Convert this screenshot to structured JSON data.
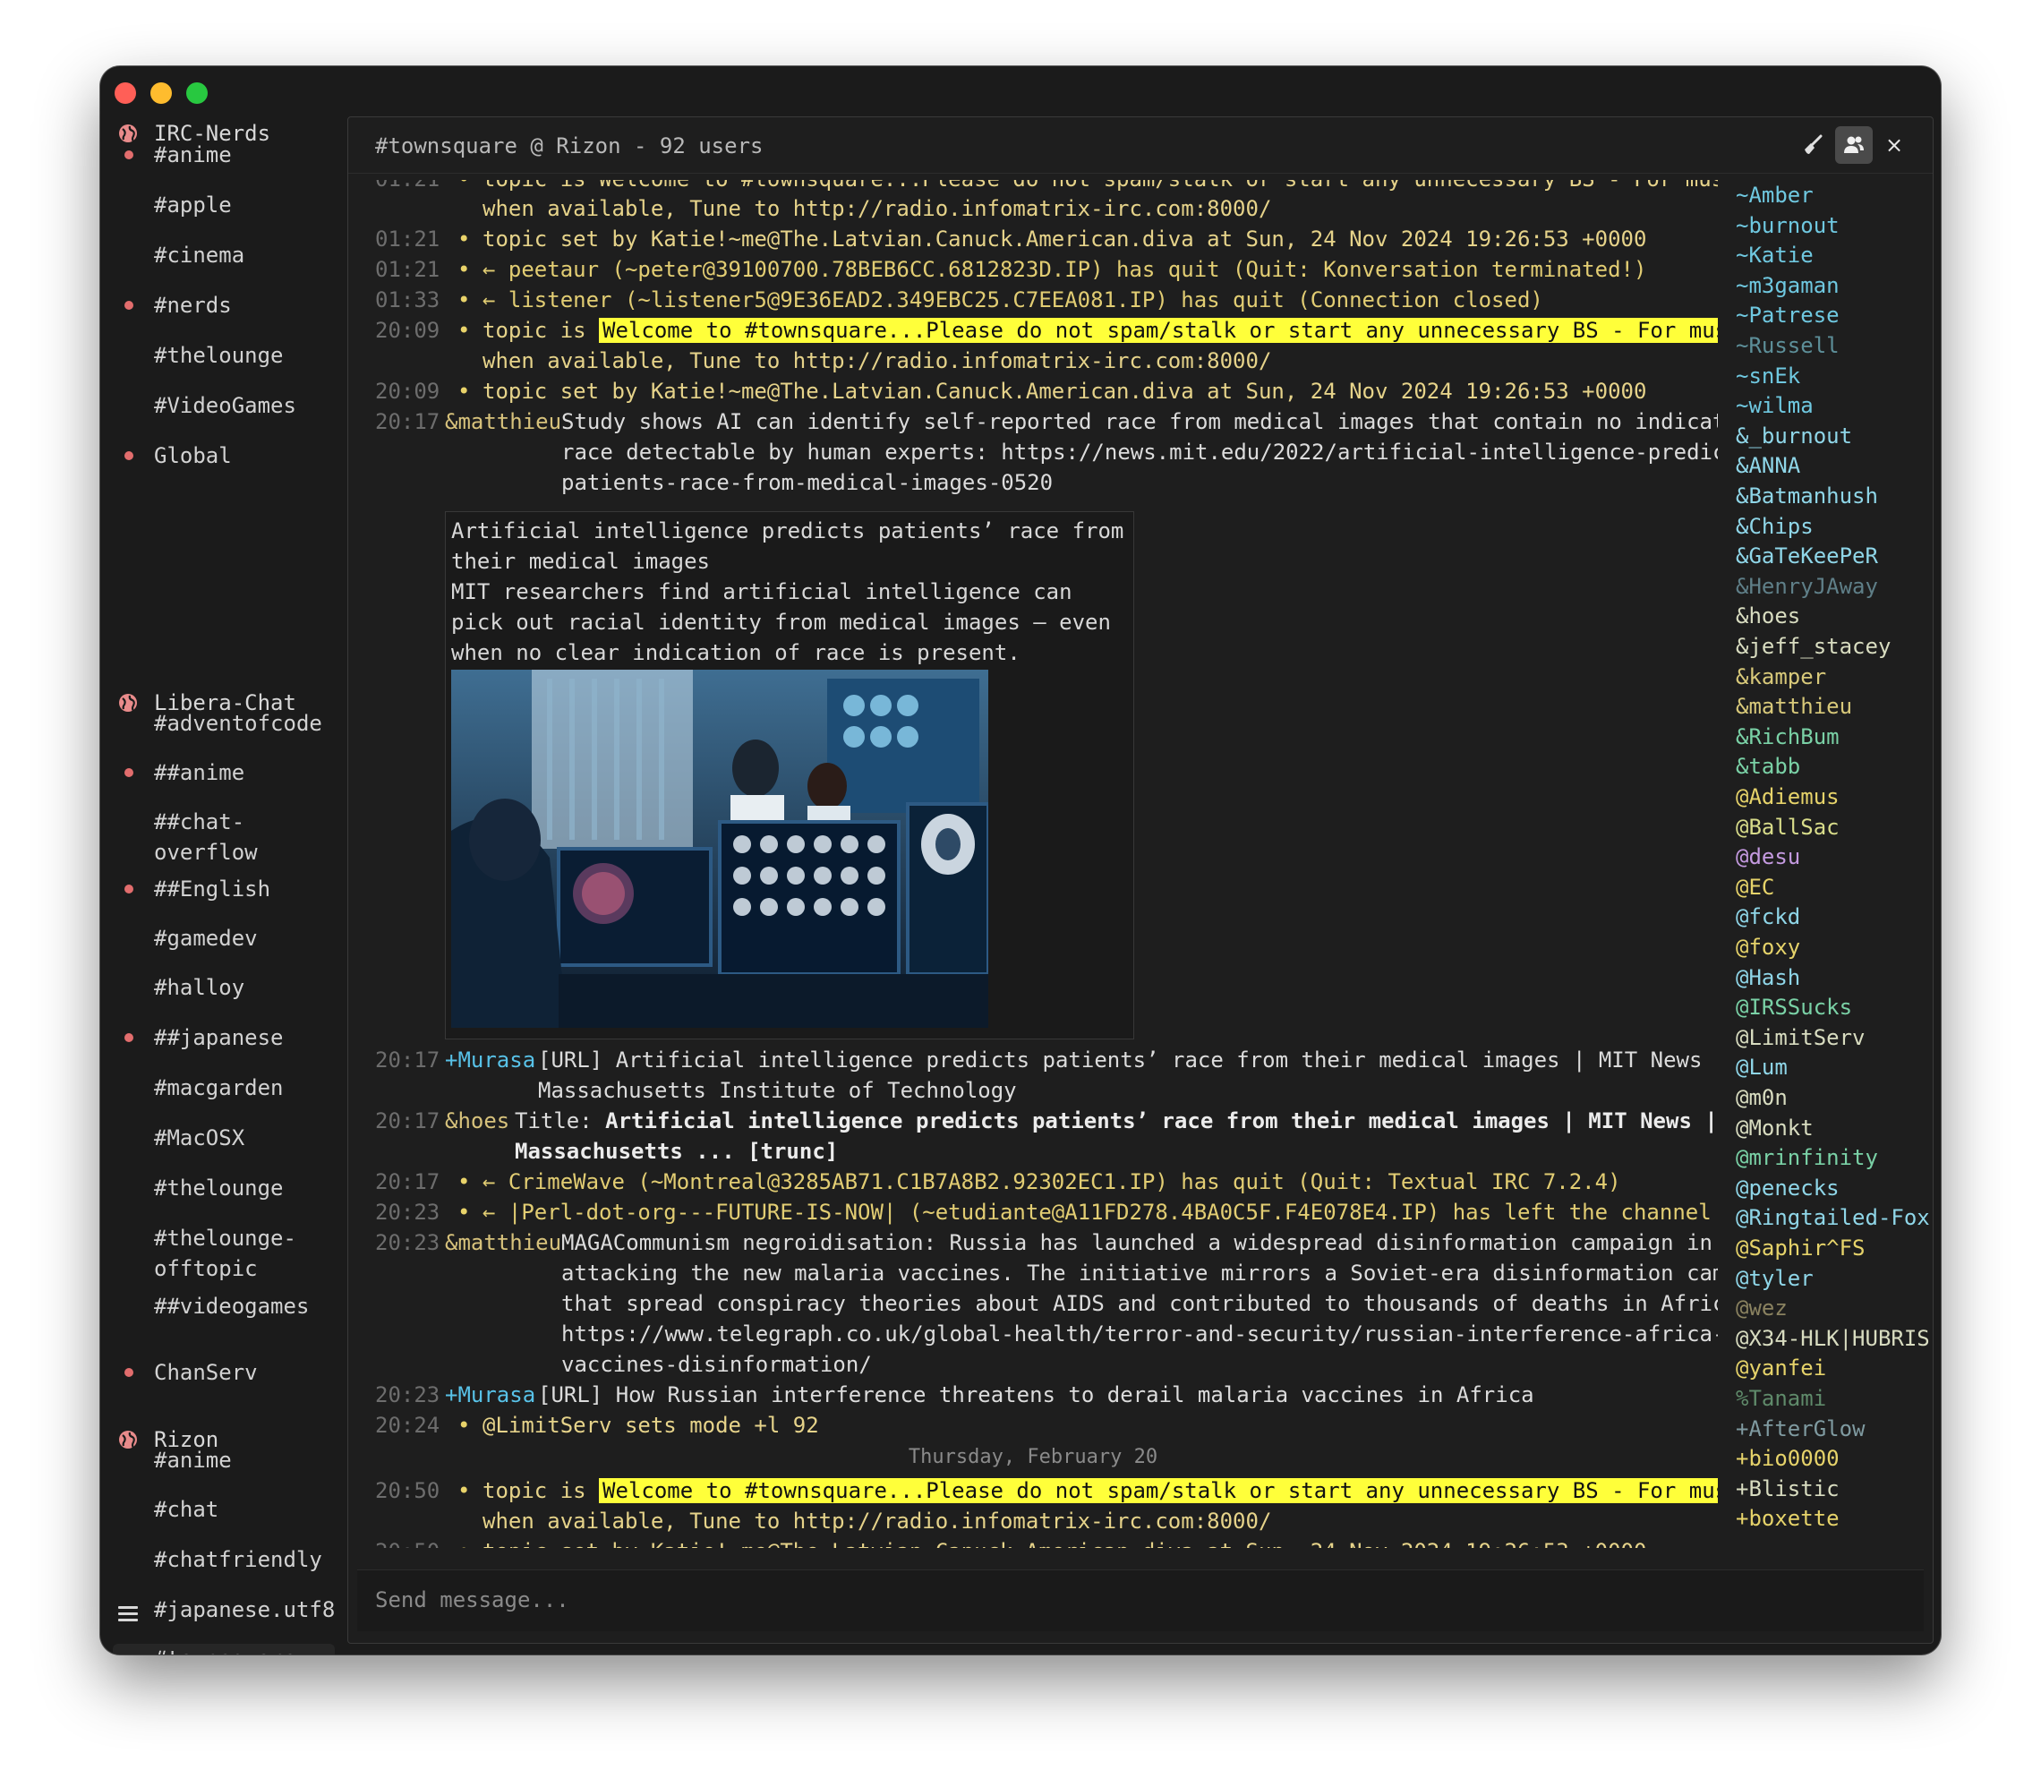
{
  "window": {
    "traffic_lights": [
      "close",
      "minimize",
      "zoom"
    ]
  },
  "sidebar": {
    "networks": [
      {
        "name": "IRC-Nerds",
        "channels": [
          {
            "label": "#anime",
            "unread": true
          },
          {
            "label": "#apple",
            "unread": false
          },
          {
            "label": "#cinema",
            "unread": false
          },
          {
            "label": "#nerds",
            "unread": true
          },
          {
            "label": "#thelounge",
            "unread": false
          },
          {
            "label": "#VideoGames",
            "unread": false
          },
          {
            "label": "Global",
            "unread": true
          }
        ]
      },
      {
        "name": "Libera-Chat",
        "channels": [
          {
            "label": "#adventofcode",
            "unread": false
          },
          {
            "label": "##anime",
            "unread": true
          },
          {
            "label": "##chat-overflow",
            "line1": "##chat-",
            "line2": "overflow",
            "unread": false
          },
          {
            "label": "##English",
            "unread": true
          },
          {
            "label": "#gamedev",
            "unread": false
          },
          {
            "label": "#halloy",
            "unread": false
          },
          {
            "label": "##japanese",
            "unread": true
          },
          {
            "label": "#macgarden",
            "unread": false
          },
          {
            "label": "#MacOSX",
            "unread": false
          },
          {
            "label": "#thelounge",
            "unread": false
          },
          {
            "label": "#thelounge-offtopic",
            "line1": "#thelounge-",
            "line2": "offtopic",
            "unread": false
          },
          {
            "label": "##videogames",
            "unread": false
          },
          {
            "label": "ChanServ",
            "unread": true
          }
        ]
      },
      {
        "name": "Rizon",
        "channels": [
          {
            "label": "#anime",
            "unread": false
          },
          {
            "label": "#chat",
            "unread": false
          },
          {
            "label": "#chatfriendly",
            "unread": false
          },
          {
            "label": "#japanese.utf8",
            "unread": false
          },
          {
            "label": "#townsquare",
            "unread": false,
            "active": true
          }
        ]
      }
    ],
    "menu_icon": "hamburger-menu-icon"
  },
  "header": {
    "title": "#townsquare @ Rizon - 92 users",
    "buttons": [
      {
        "icon": "broom-icon",
        "label": "clear"
      },
      {
        "icon": "users-icon",
        "label": "toggle nicklist"
      },
      {
        "icon": "close-icon",
        "label": "×"
      }
    ]
  },
  "messages": {
    "cutoff_top": {
      "ts": "01:21",
      "text": "topic is  Welcome to #townsquare...Please do not spam/stalk or start any unnecessary BS  -   For music and"
    },
    "line_cont_1": "when available, Tune to http://radio.infomatrix-irc.com:8000/",
    "m1": {
      "ts": "01:21",
      "text": "topic set by Katie!~me@The.Latvian.Canuck.American.diva at Sun, 24 Nov 2024 19:26:53 +0000"
    },
    "m2": {
      "ts": "01:21",
      "text": "← peetaur (~peter@39100700.78BEB6CC.6812823D.IP) has quit (Quit: Konversation terminated!)"
    },
    "m3": {
      "ts": "01:33",
      "text": "← listener (~listener5@9E36EAD2.349EBC25.C7EEA081.IP) has quit (Connection closed)"
    },
    "m4": {
      "ts": "20:09",
      "prefix": "topic is",
      "highlight": "Welcome to #townsquare...Please do not spam/stalk or start any unnecessary BS  -   For music and",
      "cont": "when available, Tune to http://radio.infomatrix-irc.com:8000/"
    },
    "m5": {
      "ts": "20:09",
      "text": "topic set by Katie!~me@The.Latvian.Canuck.American.diva at Sun, 24 Nov 2024 19:26:53 +0000"
    },
    "m6": {
      "ts": "20:17",
      "nick": "&matthieu",
      "l1": "Study shows AI can identify self-reported race from medical images that contain no indications of",
      "l2": "race detectable by human experts: https://news.mit.edu/2022/artificial-intelligence-predicts-",
      "l3": "patients-race-from-medical-images-0520"
    },
    "preview": {
      "title": "Artificial intelligence predicts patients’ race from their medical images",
      "description": "MIT researchers find artificial intelligence can pick out racial identity from medical images — even when no clear indication of race is present.",
      "image_alt": "Medical researchers viewing brain scans on monitors"
    },
    "m7": {
      "ts": "20:17",
      "nick": "+Murasa",
      "l1": "[URL] Artificial intelligence predicts patients’ race from their medical images | MIT News |",
      "l2": "Massachusetts Institute of Technology"
    },
    "m8": {
      "ts": "20:17",
      "nick": "&hoes",
      "l1_prefix": "Title:",
      "l1": "Artificial intelligence predicts patients’ race from their medical images | MIT News |",
      "l2": "Massachusetts ... [trunc]"
    },
    "m9": {
      "ts": "20:17",
      "text": "← CrimeWave (~Montreal@3285AB71.C1B7A8B2.92302EC1.IP) has quit (Quit: Textual IRC 7.2.4)"
    },
    "m10": {
      "ts": "20:23",
      "text": "← |Perl-dot-org---FUTURE-IS-NOW| (~etudiante@A11FD278.4BA0C5F.F4E078E4.IP) has left the channel (.)"
    },
    "m11": {
      "ts": "20:23",
      "nick": "&matthieu",
      "l1": "MAGACommunism negroidisation: Russia has launched a widespread disinformation campaign in Africa",
      "l2": "attacking the new malaria vaccines. The initiative mirrors a Soviet-era disinformation campaign",
      "l3": "that spread conspiracy theories about AIDS and contributed to thousands of deaths in Africa:",
      "l4": "https://www.telegraph.co.uk/global-health/terror-and-security/russian-interference-africa-malaria-",
      "l5": "vaccines-disinformation/"
    },
    "m12": {
      "ts": "20:23",
      "nick": "+Murasa",
      "text": "[URL] How Russian interference threatens to derail malaria vaccines in Africa"
    },
    "m13": {
      "ts": "20:24",
      "text": "@LimitServ sets mode +l 92"
    },
    "date_divider": "Thursday, February 20",
    "m14": {
      "ts": "20:50",
      "prefix": "topic is",
      "highlight": "Welcome to #townsquare...Please do not spam/stalk or start any unnecessary BS  -   For music and",
      "cont": "when available, Tune to http://radio.infomatrix-irc.com:8000/"
    },
    "m15": {
      "ts": "20:50",
      "text": "topic set by Katie!~me@The.Latvian.Canuck.American.diva at Sun, 24 Nov 2024 19:26:53 +0000"
    }
  },
  "input": {
    "placeholder": "Send message..."
  },
  "userlist": [
    {
      "nick": "~Amber",
      "color": "#6fc8e0"
    },
    {
      "nick": "~burnout",
      "color": "#6fc8e0"
    },
    {
      "nick": "~Katie",
      "color": "#6fc8e0"
    },
    {
      "nick": "~m3gaman",
      "color": "#6fc8e0"
    },
    {
      "nick": "~Patrese",
      "color": "#6fc8e0"
    },
    {
      "nick": "~Russell",
      "color": "#5d8f99"
    },
    {
      "nick": "~snEk",
      "color": "#6fc8e0"
    },
    {
      "nick": "~wilma",
      "color": "#6fc8e0"
    },
    {
      "nick": "&_burnout",
      "color": "#8fd6e8"
    },
    {
      "nick": "&ANNA",
      "color": "#8fd6e8"
    },
    {
      "nick": "&Batmanhush",
      "color": "#8fd6e8"
    },
    {
      "nick": "&Chips",
      "color": "#8fd6e8"
    },
    {
      "nick": "&GaTeKeePeR",
      "color": "#8fd6e8"
    },
    {
      "nick": "&HenryJAway",
      "color": "#5f7f88"
    },
    {
      "nick": "&hoes",
      "color": "#d8dcc0"
    },
    {
      "nick": "&jeff_stacey",
      "color": "#d8dcc0"
    },
    {
      "nick": "&kamper",
      "color": "#d8c97a"
    },
    {
      "nick": "&matthieu",
      "color": "#d8c97a"
    },
    {
      "nick": "&RichBum",
      "color": "#7ad1a6"
    },
    {
      "nick": "&tabb",
      "color": "#7ad1a6"
    },
    {
      "nick": "@Adiemus",
      "color": "#e6d36a"
    },
    {
      "nick": "@BallSac",
      "color": "#d8dc8a"
    },
    {
      "nick": "@desu",
      "color": "#c49ae0"
    },
    {
      "nick": "@EC",
      "color": "#e6d36a"
    },
    {
      "nick": "@fckd",
      "color": "#8fd6e8"
    },
    {
      "nick": "@foxy",
      "color": "#e6d36a"
    },
    {
      "nick": "@Hash",
      "color": "#8fd6e8"
    },
    {
      "nick": "@IRSSucks",
      "color": "#7ad1a6"
    },
    {
      "nick": "@LimitServ",
      "color": "#d8dcc0"
    },
    {
      "nick": "@Lum",
      "color": "#8fd6e8"
    },
    {
      "nick": "@m0n",
      "color": "#d8dcc0"
    },
    {
      "nick": "@Monkt",
      "color": "#d8dcc0"
    },
    {
      "nick": "@mrinfinity",
      "color": "#7ad1a6"
    },
    {
      "nick": "@penecks",
      "color": "#8fd6e8"
    },
    {
      "nick": "@Ringtailed-Fox",
      "color": "#8fd6e8"
    },
    {
      "nick": "@Saphir^FS",
      "color": "#e6d36a"
    },
    {
      "nick": "@tyler",
      "color": "#8fd6e8"
    },
    {
      "nick": "@wez",
      "color": "#8a8260"
    },
    {
      "nick": "@X34-HLK|HUBRIS",
      "color": "#d8dcc0"
    },
    {
      "nick": "@yanfei",
      "color": "#e6d36a"
    },
    {
      "nick": "%Tanami",
      "color": "#5f8a6a"
    },
    {
      "nick": "+AfterGlow",
      "color": "#7f9aa0"
    },
    {
      "nick": "+bio0000",
      "color": "#e6d36a"
    },
    {
      "nick": "+Blistic",
      "color": "#d8dcc0"
    },
    {
      "nick": "+boxette",
      "color": "#e6d36a"
    }
  ],
  "colors": {
    "background": "#1b1b1b",
    "highlight": "#ffff3a",
    "event_text": "#e6d38a",
    "timestamp": "#6d6d6d",
    "unread_dot": "#e26d6d",
    "nick_voice": "#58c2e8",
    "nick_op": "#d7c27c"
  }
}
